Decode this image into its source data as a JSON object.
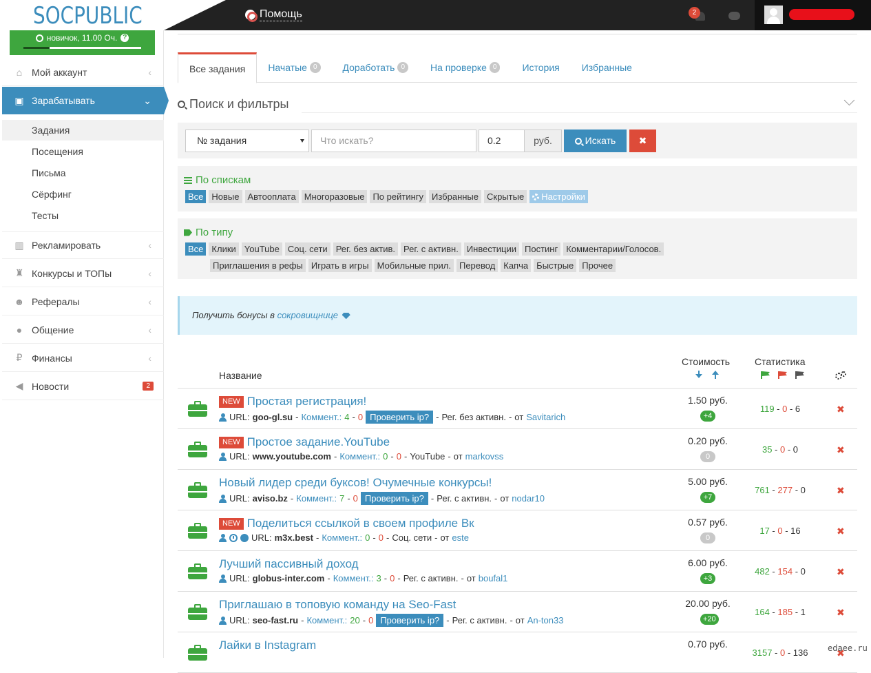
{
  "header": {
    "logo": "SOCPUBLIC",
    "help_label": "Помощь",
    "notifications_count": "2"
  },
  "sidebar": {
    "level_label": "новичок, 11.00 Оч.",
    "level_help": "?",
    "level_progress": 0.22,
    "items": [
      {
        "label": "Мой аккаунт",
        "icon": "home-icon"
      },
      {
        "label": "Зарабатывать",
        "icon": "briefcase-icon"
      },
      {
        "label": "Рекламировать",
        "icon": "bar-chart-icon"
      },
      {
        "label": "Конкурсы и ТОПы",
        "icon": "trophy-icon"
      },
      {
        "label": "Рефералы",
        "icon": "users-icon"
      },
      {
        "label": "Общение",
        "icon": "chat-icon"
      },
      {
        "label": "Финансы",
        "icon": "ruble-icon"
      },
      {
        "label": "Новости",
        "icon": "megaphone-icon",
        "badge": "2"
      }
    ],
    "sub_items": [
      "Задания",
      "Посещения",
      "Письма",
      "Сёрфинг",
      "Тесты"
    ]
  },
  "tabs": [
    {
      "label": "Все задания"
    },
    {
      "label": "Начатые",
      "count": "0"
    },
    {
      "label": "Доработать",
      "count": "0"
    },
    {
      "label": "На проверке",
      "count": "0"
    },
    {
      "label": "История"
    },
    {
      "label": "Избранные"
    }
  ],
  "filters": {
    "title": "Поиск и фильтры",
    "select_value": "№ задания",
    "query_placeholder": "Что искать?",
    "price_value": "0.2",
    "currency": "руб.",
    "search_label": "Искать",
    "clear_label": "✖",
    "by_list": {
      "title": "По спискам",
      "chips": [
        "Все",
        "Новые",
        "Автооплата",
        "Многоразовые",
        "По рейтингу",
        "Избранные",
        "Скрытые"
      ],
      "settings_label": "Настройки"
    },
    "by_type": {
      "title": "По типу",
      "row1": [
        "Все",
        "Клики",
        "YouTube",
        "Соц. сети",
        "Рег. без актив.",
        "Рег. с активн.",
        "Инвестиции",
        "Постинг",
        "Комментарии/Голосов."
      ],
      "row2": [
        "Приглашения в рефы",
        "Играть в игры",
        "Мобильные прил.",
        "Перевод",
        "Капча",
        "Быстрые",
        "Прочее"
      ]
    }
  },
  "alert": {
    "text": "Получить бонусы в",
    "link": "сокровищнице"
  },
  "table": {
    "col_name": "Название",
    "col_cost": "Стоимость",
    "col_stats": "Статистика",
    "rows": [
      {
        "new": "NEW",
        "title": "Простая регистрация!",
        "url_label": "URL:",
        "url": "goo-gl.su",
        "comment_label": "Коммент.:",
        "c1": "4",
        "c2": "0",
        "check": "Проверить ip?",
        "type": "Рег. без активн.",
        "from": "от",
        "author": "Savitarich",
        "cost": "1.50 руб.",
        "bonus": "+4",
        "bonus_color": "green",
        "s1": "119",
        "s2": "0",
        "s3": "6"
      },
      {
        "new": "NEW",
        "title": "Простое задание.YouTube",
        "url_label": "URL:",
        "url": "www.youtube.com",
        "comment_label": "Коммент.:",
        "c1": "0",
        "c2": "0",
        "check": "",
        "type": "YouTube",
        "from": "от",
        "author": "markovss",
        "cost": "0.20 руб.",
        "bonus": "0",
        "bonus_color": "grey",
        "s1": "35",
        "s2": "0",
        "s3": "0"
      },
      {
        "new": "",
        "title": "Новый лидер среди буксов! Очумечные конкурсы!",
        "url_label": "URL:",
        "url": "aviso.bz",
        "comment_label": "Коммент.:",
        "c1": "7",
        "c2": "0",
        "check": "Проверить ip?",
        "type": "Рег. с активн.",
        "from": "от",
        "author": "nodar10",
        "cost": "5.00 руб.",
        "bonus": "+7",
        "bonus_color": "green",
        "s1": "761",
        "s2": "277",
        "s3": "0"
      },
      {
        "new": "NEW",
        "title": "Поделиться ссылкой в своем профиле Вк",
        "url_label": "URL:",
        "url": "m3x.best",
        "comment_label": "Коммент.:",
        "c1": "0",
        "c2": "0",
        "check": "",
        "type": "Соц. сети",
        "from": "от",
        "author": "este",
        "cost": "0.57 руб.",
        "bonus": "0",
        "bonus_color": "grey",
        "s1": "17",
        "s2": "0",
        "s3": "16",
        "extra_icons": true
      },
      {
        "new": "",
        "title": "Лучший пассивный доход",
        "url_label": "URL:",
        "url": "globus-inter.com",
        "comment_label": "Коммент.:",
        "c1": "3",
        "c2": "0",
        "check": "",
        "type": "Рег. с активн.",
        "from": "от",
        "author": "boufal1",
        "cost": "6.00 руб.",
        "bonus": "+3",
        "bonus_color": "green",
        "s1": "482",
        "s2": "154",
        "s3": "0"
      },
      {
        "new": "",
        "title": "Приглашаю в топовую команду на Seo-Fast",
        "url_label": "URL:",
        "url": "seo-fast.ru",
        "comment_label": "Коммент.:",
        "c1": "20",
        "c2": "0",
        "check": "Проверить ip?",
        "type": "Рег. с активн.",
        "from": "от",
        "author": "An-ton33",
        "cost": "20.00 руб.",
        "bonus": "+20",
        "bonus_color": "green",
        "s1": "164",
        "s2": "185",
        "s3": "1"
      },
      {
        "new": "",
        "title": "Лайки в Instagram",
        "url_label": "",
        "url": "",
        "comment_label": "",
        "c1": "",
        "c2": "",
        "check": "",
        "type": "",
        "from": "",
        "author": "",
        "cost": "0.70 руб.",
        "bonus": "",
        "bonus_color": "none",
        "s1": "3157",
        "s2": "0",
        "s3": "136"
      }
    ]
  },
  "watermark": "edaee.ru",
  "colors": {
    "accent": "#3c8dbc",
    "green": "#3ea63e",
    "red": "#dd4b39",
    "dark": "#222222"
  }
}
